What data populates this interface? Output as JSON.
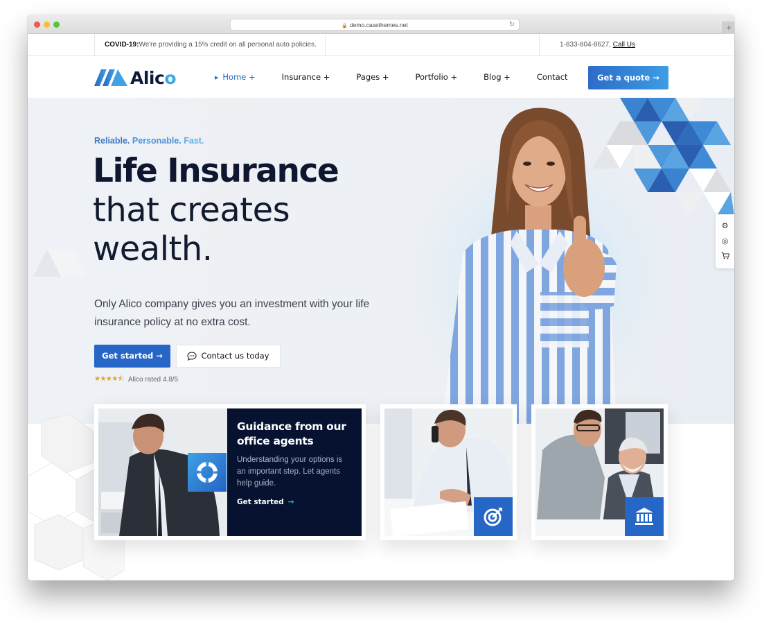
{
  "browser": {
    "url": "demo.casethemes.net",
    "new_tab_label": "+"
  },
  "topbar": {
    "notice_label": "COVID-19:",
    "notice_text": "We're providing a 15% credit on all personal auto policies.",
    "phone": "1-833-804-8627,",
    "call_link": "Call Us"
  },
  "header": {
    "logo_text_main": "Alic",
    "logo_text_accent": "o",
    "nav": [
      {
        "label": "Home +",
        "active": true
      },
      {
        "label": "Insurance +",
        "active": false
      },
      {
        "label": "Pages +",
        "active": false
      },
      {
        "label": "Portfolio +",
        "active": false
      },
      {
        "label": "Blog +",
        "active": false
      },
      {
        "label": "Contact",
        "active": false
      }
    ],
    "cta_label": "Get a quote →"
  },
  "hero": {
    "tagline": [
      "Reliable.",
      "Personable.",
      "Fast."
    ],
    "headline_bold": "Life Insurance",
    "headline_line2": "that creates",
    "headline_line3": "wealth.",
    "lede": "Only Alico company gives you an investment with your life insurance policy at no extra cost.",
    "primary_button": "Get started →",
    "secondary_button": "Contact us today",
    "rating_stars": 4.5,
    "rating_stars_glyph": "★★★★⯪",
    "rating_text": "Alico rated 4.8/5"
  },
  "side_tools": [
    {
      "icon": "gear-icon",
      "glyph": "⚙"
    },
    {
      "icon": "lifebuoy-icon",
      "glyph": "◎"
    },
    {
      "icon": "cart-icon",
      "glyph": "🛒"
    }
  ],
  "cards": [
    {
      "title": "Guidance from our office agents",
      "text": "Understanding your options is an important step. Let agents help guide.",
      "link_label": "Get started",
      "link_arrow": "→",
      "icon": "lifebuoy-icon"
    },
    {
      "icon": "target-icon"
    },
    {
      "icon": "bank-icon"
    }
  ],
  "colors": {
    "brand_blue": "#2566c7",
    "accent_light_blue": "#3aa7e8",
    "dark_navy": "#061230",
    "star_gold": "#e0a526"
  }
}
